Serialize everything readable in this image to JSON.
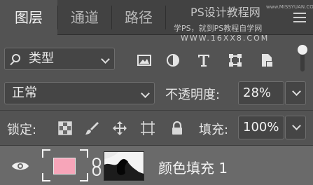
{
  "tabs": [
    {
      "label": "图层",
      "active": true
    },
    {
      "label": "通道",
      "active": false
    },
    {
      "label": "路径",
      "active": false
    }
  ],
  "watermark": {
    "line1": "PS设计教程网",
    "line1_small": "www.MISSYUAN.COM",
    "line2": "学PS，就到PS教程自学网",
    "line3": "WWW.16XX8.COM"
  },
  "filter": {
    "kind_label": "类型",
    "icons": [
      "image-filter-icon",
      "adjustment-filter-icon",
      "type-filter-icon",
      "shape-filter-icon",
      "smart-object-filter-icon"
    ]
  },
  "blend": {
    "mode": "正常",
    "opacity_label": "不透明度:",
    "opacity_value": "28%"
  },
  "lock": {
    "label": "锁定:",
    "fill_label": "填充:",
    "fill_value": "100%"
  },
  "layer": {
    "name": "颜色填充 1",
    "swatch_color": "#f7a5b9"
  }
}
